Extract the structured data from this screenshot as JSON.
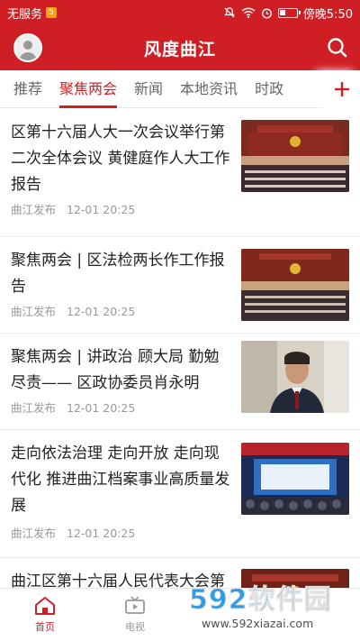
{
  "status_bar": {
    "carrier": "无服务",
    "carrier_badge": "5",
    "time_label": "傍晚5:50"
  },
  "header": {
    "title": "风度曲江"
  },
  "tabs": [
    {
      "label": "推荐"
    },
    {
      "label": "聚焦两会"
    },
    {
      "label": "新闻"
    },
    {
      "label": "本地资讯"
    },
    {
      "label": "时政"
    }
  ],
  "articles": [
    {
      "title": "区第十六届人大一次会议举行第二次全体会议 黄健庭作人大工作报告",
      "source": "曲江发布",
      "time": "12-01 20:25"
    },
    {
      "title": "聚焦两会 | 区法检两长作工作报告",
      "source": "曲江发布",
      "time": "12-01 20:25"
    },
    {
      "title": "聚焦两会 | 讲政治 顾大局 勤勉尽责—— 区政协委员肖永明",
      "source": "曲江发布",
      "time": "12-01 20:25"
    },
    {
      "title": "走向依法治理 走向开放 走向现代化 推进曲江档案事业高质量发展",
      "source": "曲江发布",
      "time": "12-01 20:25"
    },
    {
      "title": "曲江区第十六届人民代表大会第一次会议胜利闭幕 谭雷",
      "source": "",
      "time": ""
    }
  ],
  "bottom_nav": [
    {
      "label": "首页"
    },
    {
      "label": "电视"
    }
  ],
  "watermark": {
    "logo_num": "592",
    "logo_cn": "软件园",
    "url": "www.592xiazai.com"
  },
  "colors": {
    "brand_red": "#cf1f24",
    "muted": "#999999"
  }
}
